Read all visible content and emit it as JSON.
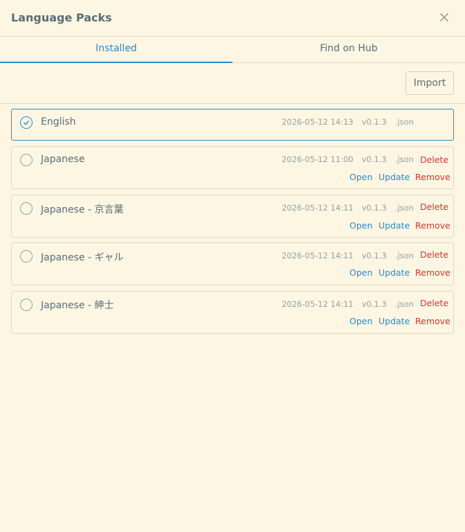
{
  "dialog": {
    "title": "Language Packs"
  },
  "tabs": [
    {
      "label": "Installed"
    },
    {
      "label": "Find on Hub"
    }
  ],
  "toolbar": {
    "import_label": "Import"
  },
  "packs": [
    {
      "name": "English",
      "date": "2026-05-12 14:13",
      "version": "v0.1.3",
      "ext": ".json",
      "selected": true
    },
    {
      "name": "Japanese",
      "date": "2026-05-12 11:00",
      "version": "v0.1.3",
      "ext": ".json",
      "selected": false
    },
    {
      "name": "Japanese - 京言葉",
      "date": "2026-05-12 14:11",
      "version": "v0.1.3",
      "ext": ".json",
      "selected": false
    },
    {
      "name": "Japanese - ギャル",
      "date": "2026-05-12 14:11",
      "version": "v0.1.3",
      "ext": ".json",
      "selected": false
    },
    {
      "name": "Japanese - 紳士",
      "date": "2026-05-12 14:11",
      "version": "v0.1.3",
      "ext": ".json",
      "selected": false
    }
  ],
  "actions": {
    "delete": "Delete",
    "open": "Open",
    "update": "Update",
    "remove": "Remove"
  },
  "colors": {
    "accent": "#268bd2",
    "danger": "#dc322f",
    "background": "#fdf6e3"
  }
}
